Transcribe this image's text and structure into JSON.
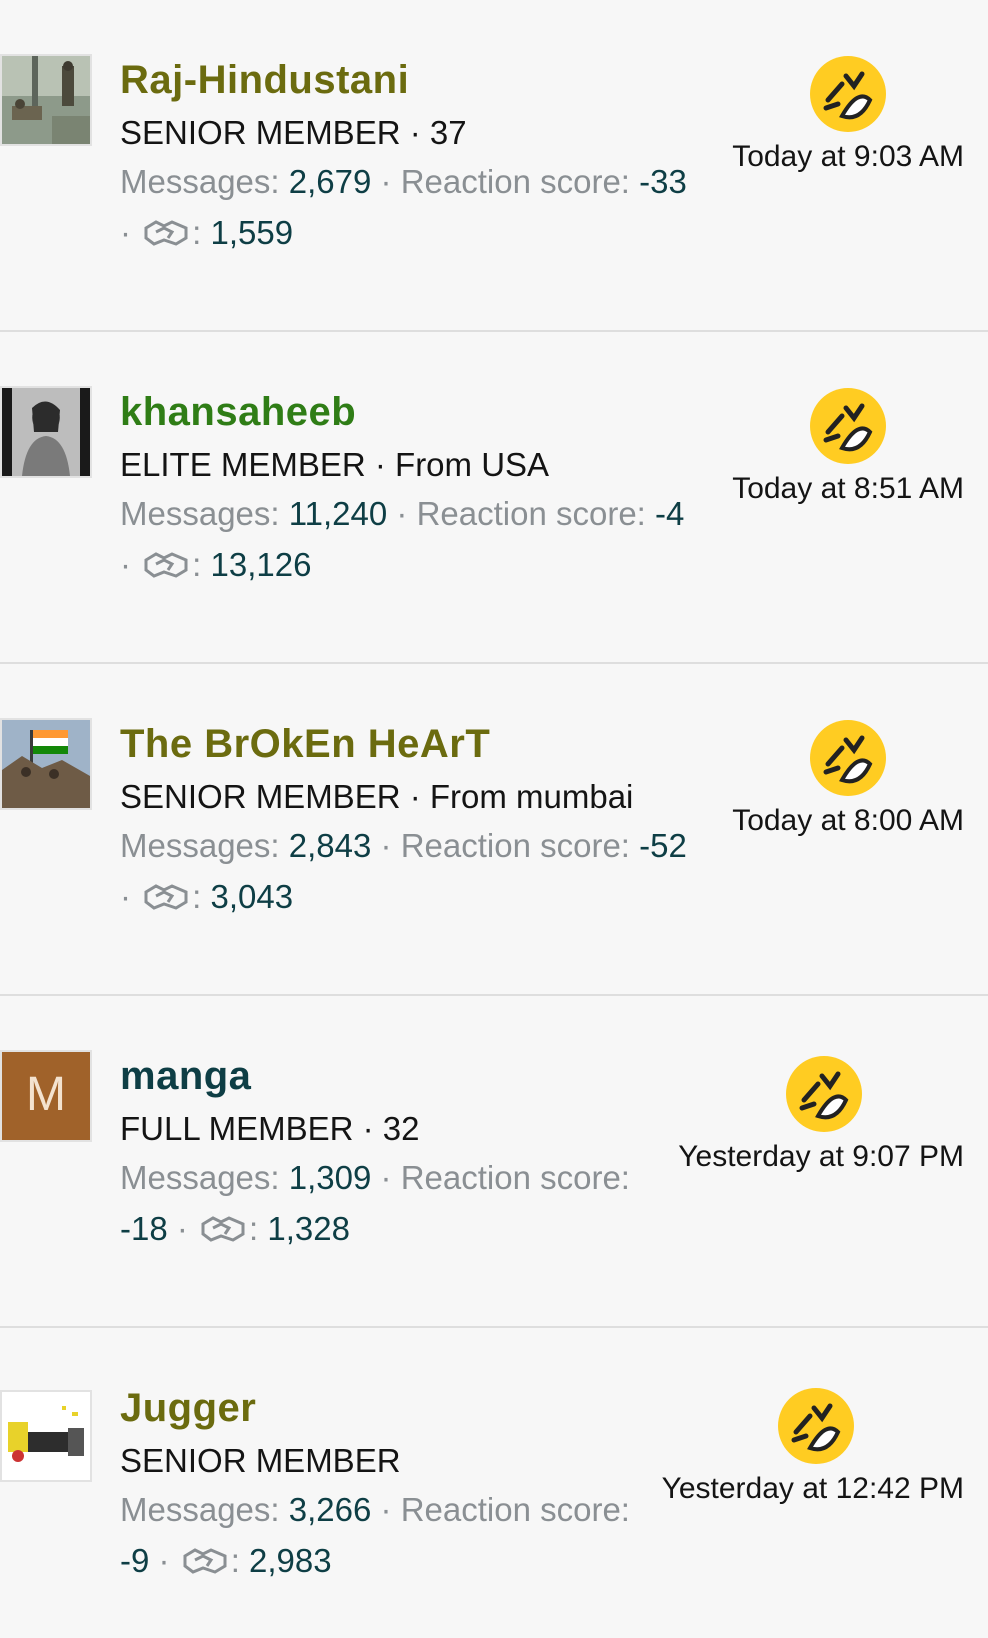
{
  "reactions": [
    {
      "username": "Raj-Hindustani",
      "username_color": "#6b6b0f",
      "role_line": "SENIOR MEMBER · 37",
      "stats": {
        "messages_label": "Messages:",
        "messages": "2,679",
        "reaction_label": "Reaction score:",
        "reaction_score": "-33",
        "handshake_score": "1,559"
      },
      "reaction_emoji": "laughing-emoji-icon",
      "timestamp": "Today at 9:03 AM"
    },
    {
      "username": "khansaheeb",
      "username_color": "#2f7d16",
      "role_line": "ELITE MEMBER · From USA",
      "stats": {
        "messages_label": "Messages:",
        "messages": "11,240",
        "reaction_label": "Reaction score:",
        "reaction_score": "-4",
        "handshake_score": "13,126"
      },
      "reaction_emoji": "laughing-emoji-icon",
      "timestamp": "Today at 8:51 AM"
    },
    {
      "username": "The BrOkEn HeArT",
      "username_color": "#6b6b0f",
      "role_line": "SENIOR MEMBER · From mumbai",
      "stats": {
        "messages_label": "Messages:",
        "messages": "2,843",
        "reaction_label": "Reaction score:",
        "reaction_score": "-52",
        "handshake_score": "3,043"
      },
      "reaction_emoji": "laughing-emoji-icon",
      "timestamp": "Today at 8:00 AM"
    },
    {
      "username": "manga",
      "username_color": "#0e3e45",
      "avatar_letter": "M",
      "role_line": "FULL MEMBER · 32",
      "stats": {
        "messages_label": "Messages:",
        "messages": "1,309",
        "reaction_label": "Reaction score:",
        "reaction_score": "-18",
        "handshake_score": "1,328"
      },
      "reaction_emoji": "laughing-emoji-icon",
      "timestamp": "Yesterday at 9:07 PM"
    },
    {
      "username": "Jugger",
      "username_color": "#6b6b0f",
      "role_line": "SENIOR MEMBER",
      "stats": {
        "messages_label": "Messages:",
        "messages": "3,266",
        "reaction_label": "Reaction score:",
        "reaction_score": "-9",
        "handshake_score": "2,983"
      },
      "reaction_emoji": "laughing-emoji-icon",
      "timestamp": "Yesterday at 12:42 PM"
    }
  ],
  "colors": {
    "muted_text": "#8a8f93",
    "stat_value": "#0e3e45",
    "emoji_yellow": "#ffcc22"
  }
}
